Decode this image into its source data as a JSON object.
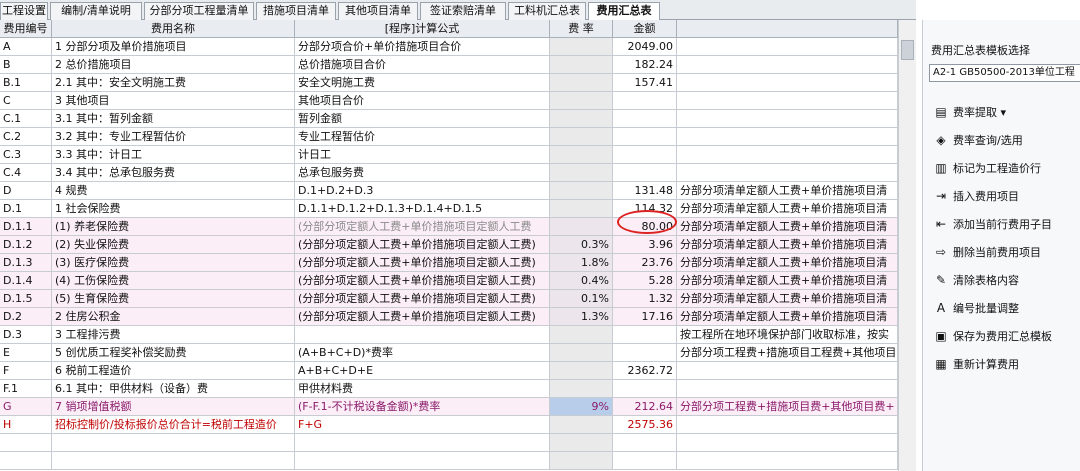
{
  "tabs": [
    "工程设置",
    "编制/清单说明",
    "分部分项工程量清单",
    "措施项目清单",
    "其他项目清单",
    "签证索赔清单",
    "工料机汇总表",
    "费用汇总表"
  ],
  "active_tab": "费用汇总表",
  "columns": [
    "费用编号",
    "费用名称",
    "[程序]计算公式",
    "费 率",
    "金额",
    ""
  ],
  "rows": [
    {
      "code": "A",
      "name": "1 分部分项及单价措施项目",
      "formula": "分部分项合价+单价措施项目合价",
      "rate": "",
      "amount": "2049.00",
      "note": ""
    },
    {
      "code": "B",
      "name": "2 总价措施项目",
      "formula": "总价措施项目合价",
      "rate": "",
      "amount": "182.24",
      "note": ""
    },
    {
      "code": "B.1",
      "name": "2.1 其中：安全文明施工费",
      "formula": "安全文明施工费",
      "rate": "",
      "amount": "157.41",
      "note": ""
    },
    {
      "code": "C",
      "name": "3 其他项目",
      "formula": "其他项目合价",
      "rate": "",
      "amount": "",
      "note": ""
    },
    {
      "code": "C.1",
      "name": "3.1 其中：暂列金额",
      "formula": "暂列金额",
      "rate": "",
      "amount": "",
      "note": ""
    },
    {
      "code": "C.2",
      "name": "3.2 其中：专业工程暂估价",
      "formula": "专业工程暂估价",
      "rate": "",
      "amount": "",
      "note": ""
    },
    {
      "code": "C.3",
      "name": "3.3 其中：计日工",
      "formula": "计日工",
      "rate": "",
      "amount": "",
      "note": ""
    },
    {
      "code": "C.4",
      "name": "3.4 其中：总承包服务费",
      "formula": "总承包服务费",
      "rate": "",
      "amount": "",
      "note": ""
    },
    {
      "code": "D",
      "name": "4 规费",
      "formula": "D.1+D.2+D.3",
      "rate": "",
      "amount": "131.48",
      "note": "分部分项清单定额人工费+单价措施项目清"
    },
    {
      "code": "D.1",
      "name": "1 社会保险费",
      "formula": "D.1.1+D.1.2+D.1.3+D.1.4+D.1.5",
      "rate": "",
      "amount": "114.32",
      "note": "分部分项清单定额人工费+单价措施项目清"
    },
    {
      "code": "D.1.1",
      "name": "(1) 养老保险费",
      "formula": "(分部分项定额人工费+单价措施项目定额人工费",
      "rate": "",
      "amount": "80.00",
      "note": "分部分项清单定额人工费+单价措施项目清"
    },
    {
      "code": "D.1.2",
      "name": "(2) 失业保险费",
      "formula": "(分部分项定额人工费+单价措施项目定额人工费)",
      "rate": "0.3%",
      "amount": "3.96",
      "note": "分部分项清单定额人工费+单价措施项目清"
    },
    {
      "code": "D.1.3",
      "name": "(3) 医疗保险费",
      "formula": "(分部分项定额人工费+单价措施项目定额人工费)",
      "rate": "1.8%",
      "amount": "23.76",
      "note": "分部分项清单定额人工费+单价措施项目清"
    },
    {
      "code": "D.1.4",
      "name": "(4) 工伤保险费",
      "formula": "(分部分项定额人工费+单价措施项目定额人工费)",
      "rate": "0.4%",
      "amount": "5.28",
      "note": "分部分项清单定额人工费+单价措施项目清"
    },
    {
      "code": "D.1.5",
      "name": "(5) 生育保险费",
      "formula": "(分部分项定额人工费+单价措施项目定额人工费)",
      "rate": "0.1%",
      "amount": "1.32",
      "note": "分部分项清单定额人工费+单价措施项目清"
    },
    {
      "code": "D.2",
      "name": "2 住房公积金",
      "formula": "(分部分项定额人工费+单价措施项目定额人工费)",
      "rate": "1.3%",
      "amount": "17.16",
      "note": "分部分项清单定额人工费+单价措施项目清"
    },
    {
      "code": "D.3",
      "name": "3 工程排污费",
      "formula": "",
      "rate": "",
      "amount": "",
      "note": "按工程所在地环境保护部门收取标准，按实"
    },
    {
      "code": "E",
      "name": "5 创优质工程奖补偿奖励费",
      "formula": "(A+B+C+D)*费率",
      "rate": "",
      "amount": "",
      "note": "分部分项工程费+措施项目工程费+其他项目"
    },
    {
      "code": "F",
      "name": "6 税前工程造价",
      "formula": "A+B+C+D+E",
      "rate": "",
      "amount": "2362.72",
      "note": ""
    },
    {
      "code": "F.1",
      "name": "6.1 其中：甲供材料（设备）费",
      "formula": "甲供材料费",
      "rate": "",
      "amount": "",
      "note": ""
    },
    {
      "code": "G",
      "name": "7 销项增值税额",
      "formula": "(F-F.1-不计税设备金额)*费率",
      "rate": "9%",
      "amount": "212.64",
      "note": "分部分项工程费+措施项目费+其他项目费+"
    },
    {
      "code": "H",
      "name": "招标控制价/投标报价总价合计=税前工程造价",
      "formula": "F+G",
      "rate": "",
      "amount": "2575.36",
      "note": ""
    },
    {
      "code": "",
      "name": "",
      "formula": "",
      "rate": "",
      "amount": "",
      "note": ""
    },
    {
      "code": "",
      "name": "",
      "formula": "",
      "rate": "",
      "amount": "",
      "note": ""
    }
  ],
  "right_panel": {
    "title": "费用汇总表模板选择",
    "template": "A2-1 GB50500-2013单位工程",
    "buttons": [
      {
        "label": "费率提取",
        "icon": "rate-extract-icon",
        "glyph": "▤"
      },
      {
        "label": "费率查询/选用",
        "icon": "rate-query-icon",
        "glyph": "◈"
      },
      {
        "label": "标记为工程造价行",
        "icon": "mark-icon",
        "glyph": "▥"
      },
      {
        "label": "插入费用项目",
        "icon": "insert-icon",
        "glyph": "⇥"
      },
      {
        "label": "添加当前行费用子目",
        "icon": "add-sub-icon",
        "glyph": "⇤"
      },
      {
        "label": "删除当前费用项目",
        "icon": "delete-icon",
        "glyph": "⇨"
      },
      {
        "label": "清除表格内容",
        "icon": "eraser-icon",
        "glyph": "✎"
      },
      {
        "label": "编号批量调整",
        "icon": "renumber-icon",
        "glyph": "A"
      },
      {
        "label": "保存为费用汇总模板",
        "icon": "save-template-icon",
        "glyph": "▣"
      },
      {
        "label": "重新计算费用",
        "icon": "calculator-icon",
        "glyph": "▦"
      }
    ]
  }
}
